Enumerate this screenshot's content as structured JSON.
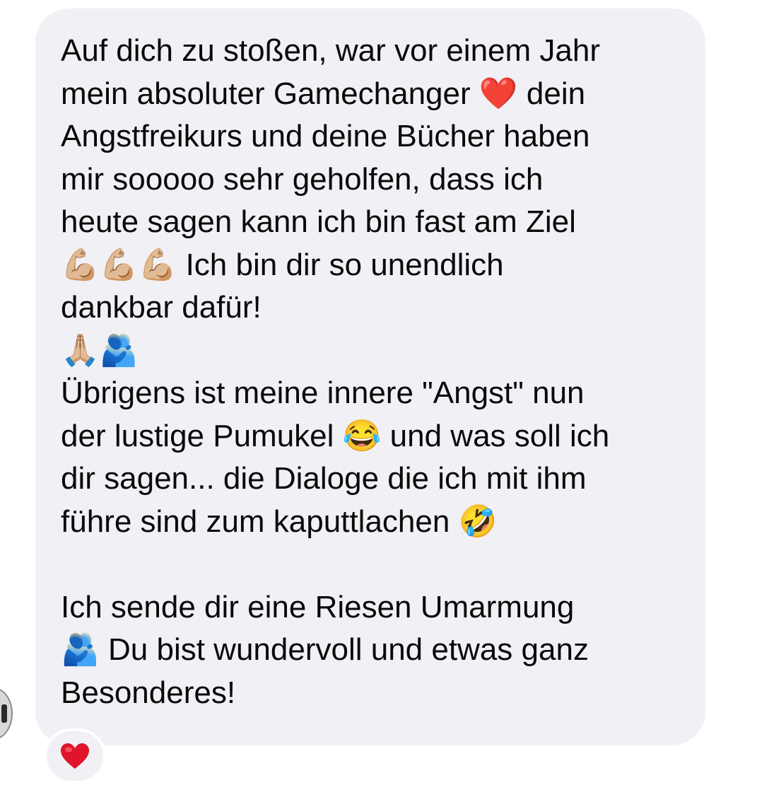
{
  "message": {
    "text": "Auf dich zu stoßen, war vor einem Jahr\nmein absoluter Gamechanger ❤️ dein\nAngstfreikurs und deine Bücher haben\nmir sooooo sehr geholfen, dass ich\nheute sagen kann ich bin fast am Ziel\n💪🏼💪🏼💪🏼 Ich bin dir so unendlich\ndankbar dafür!\n🙏🏼🫂\nÜbrigens ist meine innere \"Angst\" nun\nder lustige Pumukel 😂 und was soll ich\ndir sagen... die Dialoge die ich mit ihm\nführe sind zum kaputtlachen 🤣\n\nIch sende dir eine Riesen Umarmung\n🫂 Du bist wundervoll und etwas ganz\nBesonderes!"
  },
  "reaction": {
    "icon": "heart-icon",
    "color": "#e0142a"
  },
  "colors": {
    "bubble": "#f0f0f5",
    "text": "#0a0a0a",
    "background": "#ffffff"
  }
}
